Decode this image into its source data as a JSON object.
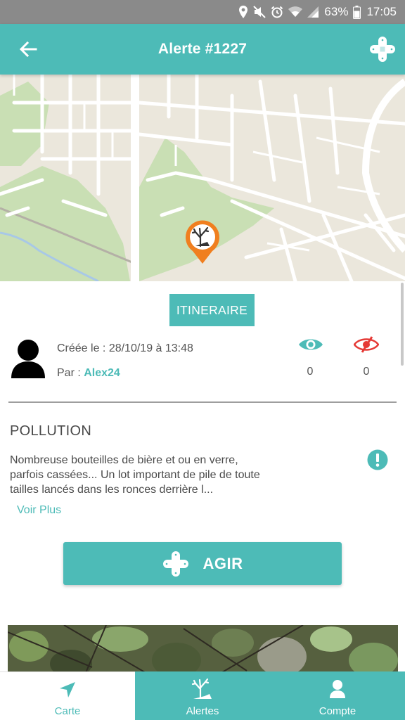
{
  "status_bar": {
    "battery": "63%",
    "time": "17:05",
    "icons": [
      "location-icon",
      "mute-icon",
      "alarm-icon",
      "wifi-icon",
      "signal-icon",
      "battery-icon"
    ]
  },
  "header": {
    "title": "Alerte #1227",
    "back_icon": "back-arrow-icon",
    "action_icon": "bandage-plus-icon"
  },
  "map": {
    "marker_icon": "pollution-marker-icon"
  },
  "alert": {
    "route_label": "ITINERAIRE",
    "created_prefix": "Créée le : ",
    "created_value": "28/10/19 à 13:48",
    "author_prefix": "Par : ",
    "author": "Alex24",
    "views_count": "0",
    "dismiss_count": "0",
    "category": "POLLUTION",
    "description": "Nombreuse bouteilles de bière et ou en verre, parfois cassées... Un lot important de pile de toute tailles lancés dans les ronces derrière l...",
    "more_label": "Voir Plus",
    "act_label": "AGIR"
  },
  "nav": {
    "items": [
      {
        "label": "Carte",
        "icon": "navigation-arrow-icon",
        "active": true
      },
      {
        "label": "Alertes",
        "icon": "pollution-tree-icon",
        "active": false
      },
      {
        "label": "Compte",
        "icon": "user-icon",
        "active": false
      }
    ]
  },
  "colors": {
    "accent": "#4dbbb7",
    "status_bar": "#8a8a8a",
    "marker": "#f07f1f",
    "dismiss_red": "#e53935",
    "text": "#4a4a4a"
  }
}
